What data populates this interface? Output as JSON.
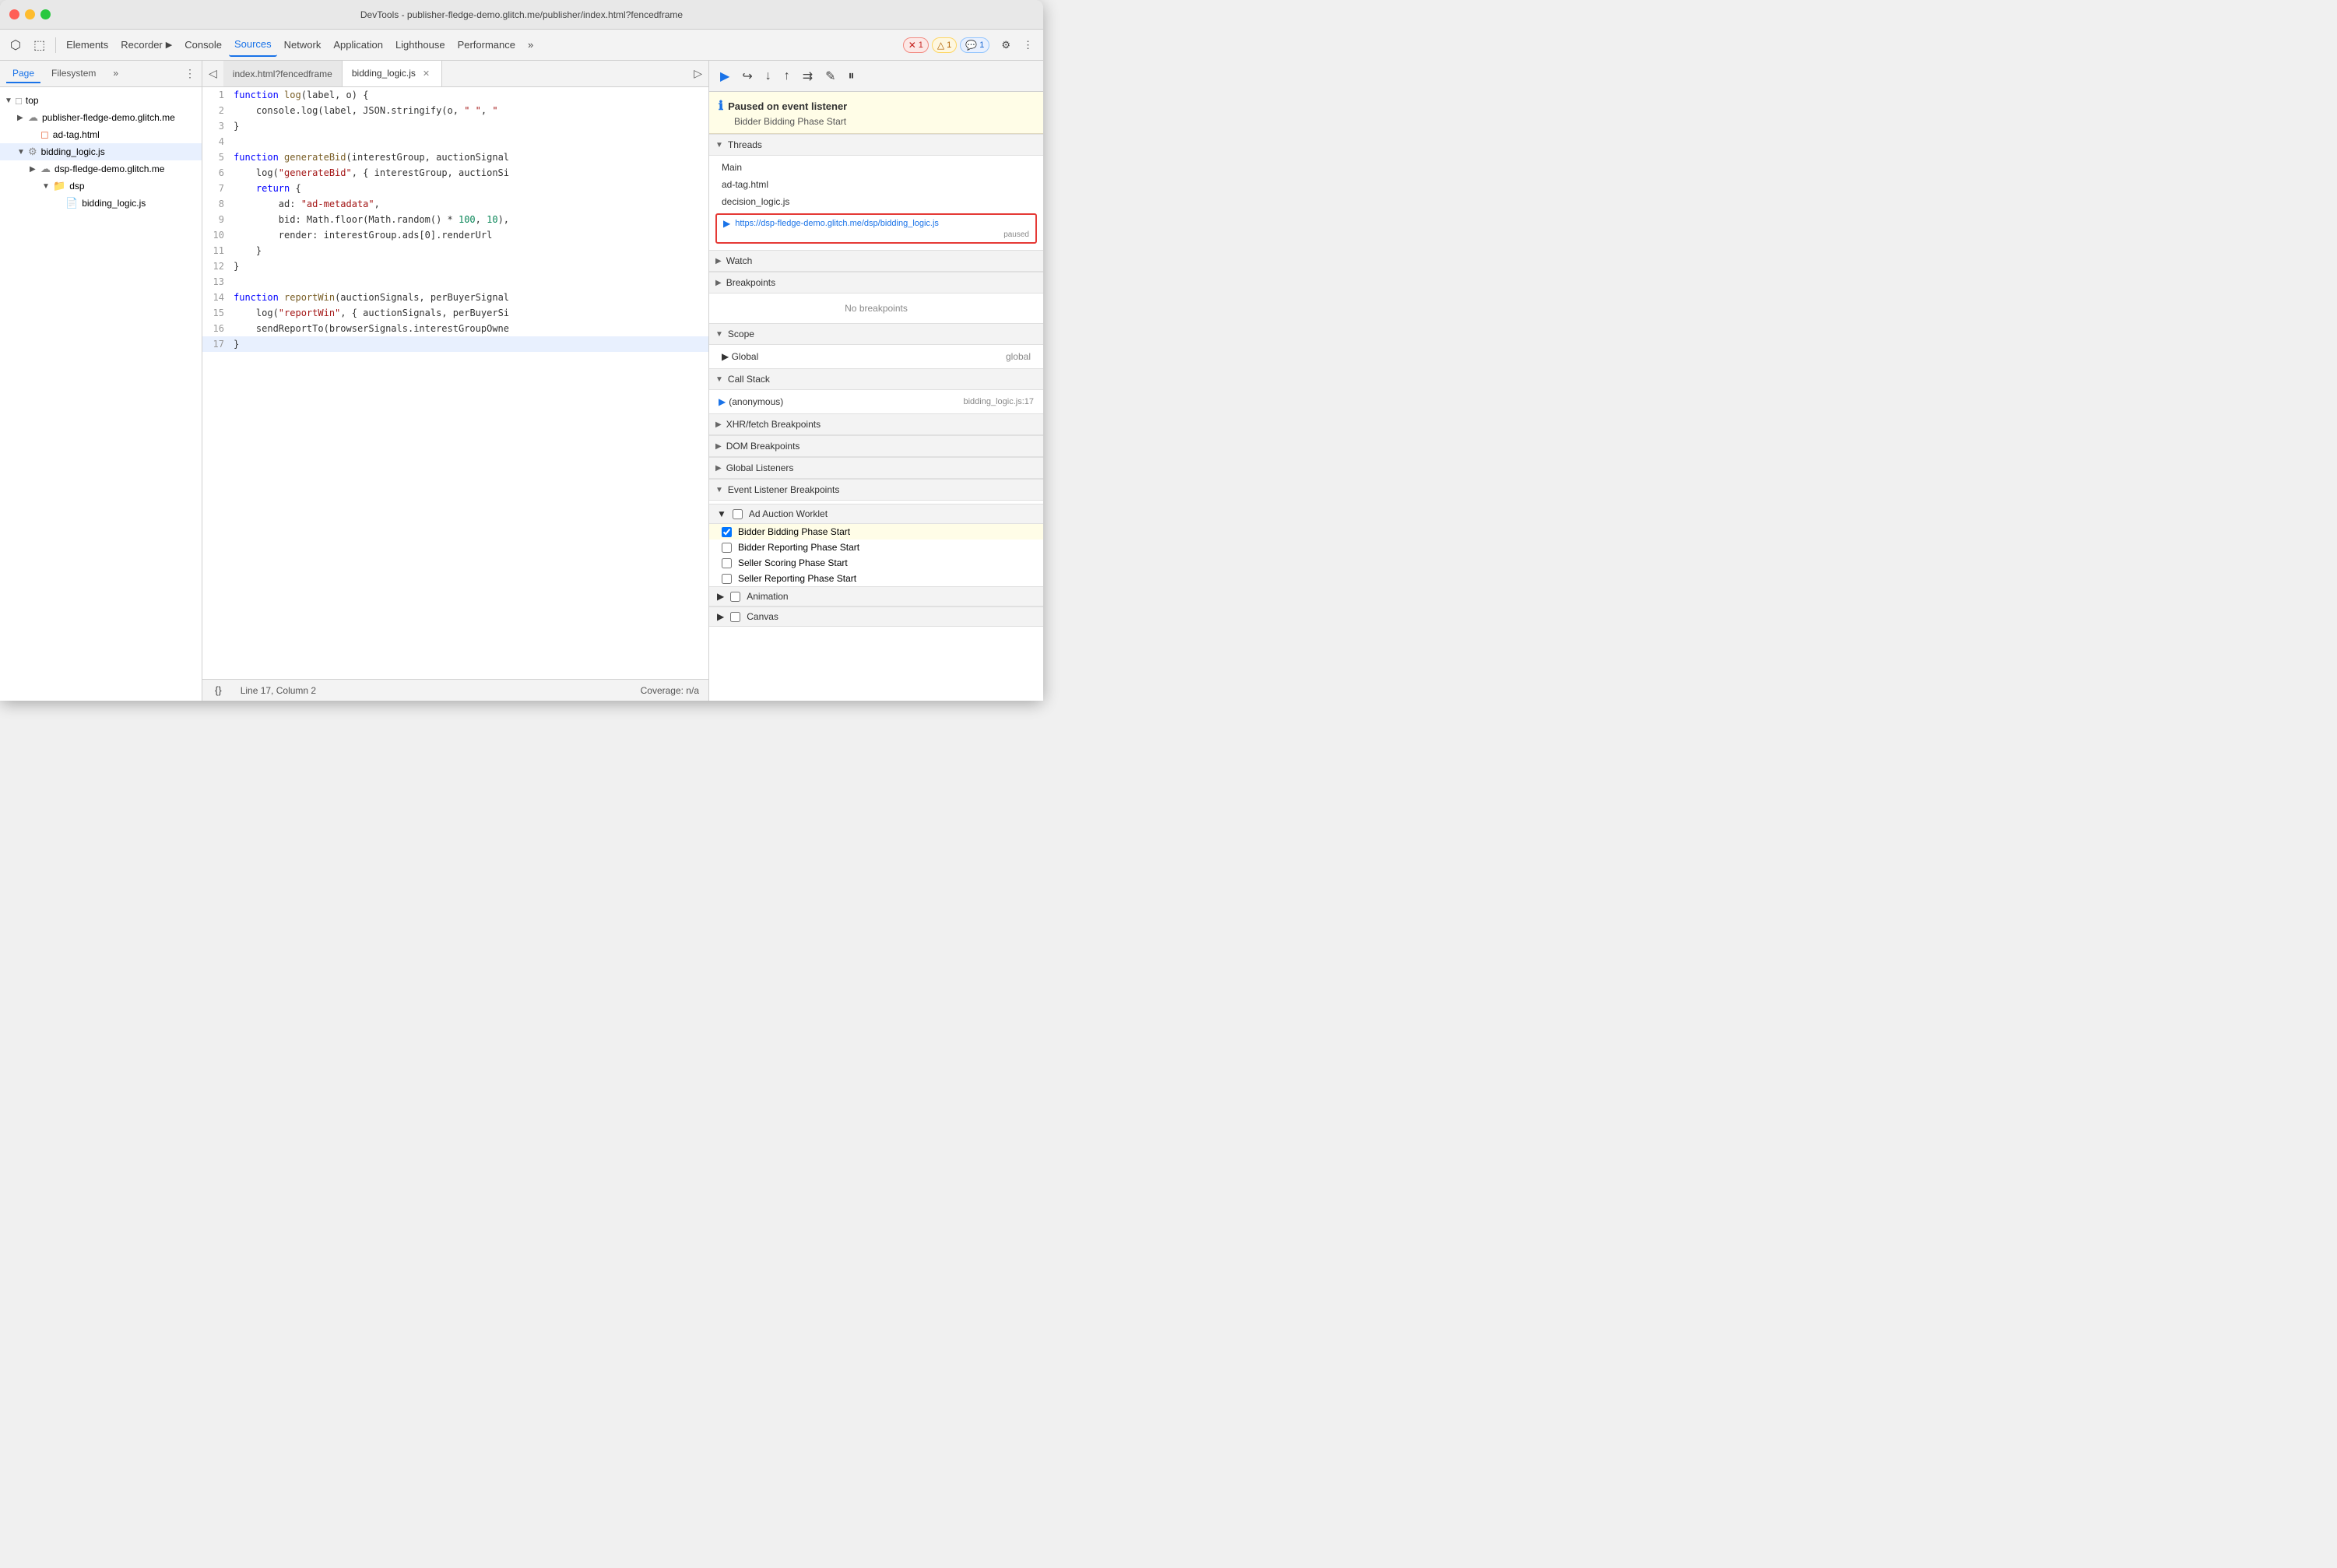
{
  "titleBar": {
    "title": "DevTools - publisher-fledge-demo.glitch.me/publisher/index.html?fencedframe"
  },
  "toolbar": {
    "cursor_btn": "⬡",
    "inspect_btn": "⬚",
    "elements_label": "Elements",
    "recorder_label": "Recorder",
    "recorder_icon": "▶",
    "console_label": "Console",
    "sources_label": "Sources",
    "network_label": "Network",
    "application_label": "Application",
    "lighthouse_label": "Lighthouse",
    "performance_label": "Performance",
    "more_label": "»",
    "badge_error_count": "1",
    "badge_warning_count": "1",
    "badge_info_count": "1",
    "settings_icon": "⚙",
    "more_icon": "⋮"
  },
  "sidebar": {
    "tab_page": "Page",
    "tab_filesystem": "Filesystem",
    "more_tabs": "»",
    "tree": [
      {
        "indent": 0,
        "arrow": "▼",
        "icon": "□",
        "icon_type": "folder",
        "label": "top"
      },
      {
        "indent": 1,
        "arrow": "▶",
        "icon": "☁",
        "icon_type": "domain",
        "label": "publisher-fledge-demo.glitch.me"
      },
      {
        "indent": 2,
        "arrow": "",
        "icon": "◻",
        "icon_type": "html",
        "label": "ad-tag.html"
      },
      {
        "indent": 1,
        "arrow": "▼",
        "icon": "⚙",
        "icon_type": "js",
        "label": "bidding_logic.js",
        "selected": true
      },
      {
        "indent": 2,
        "arrow": "▶",
        "icon": "☁",
        "icon_type": "domain",
        "label": "dsp-fledge-demo.glitch.me"
      },
      {
        "indent": 3,
        "arrow": "▼",
        "icon": "📁",
        "icon_type": "folder",
        "label": "dsp"
      },
      {
        "indent": 4,
        "arrow": "",
        "icon": "📄",
        "icon_type": "jsfile",
        "label": "bidding_logic.js"
      }
    ]
  },
  "editorTabs": [
    {
      "label": "index.html?fencedframe",
      "active": false,
      "closeable": false
    },
    {
      "label": "bidding_logic.js",
      "active": true,
      "closeable": true
    }
  ],
  "code": {
    "lines": [
      {
        "num": 1,
        "text": "function log(label, o) {",
        "highlighted": false
      },
      {
        "num": 2,
        "text": "    console.log(label, JSON.stringify(o, \" \", \"",
        "highlighted": false
      },
      {
        "num": 3,
        "text": "}",
        "highlighted": false
      },
      {
        "num": 4,
        "text": "",
        "highlighted": false
      },
      {
        "num": 5,
        "text": "function generateBid(interestGroup, auctionSignal",
        "highlighted": false
      },
      {
        "num": 6,
        "text": "    log(\"generateBid\", { interestGroup, auctionSi",
        "highlighted": false
      },
      {
        "num": 7,
        "text": "    return {",
        "highlighted": false
      },
      {
        "num": 8,
        "text": "        ad: \"ad-metadata\",",
        "highlighted": false
      },
      {
        "num": 9,
        "text": "        bid: Math.floor(Math.random() * 100, 10),",
        "highlighted": false
      },
      {
        "num": 10,
        "text": "        render: interestGroup.ads[0].renderUrl",
        "highlighted": false
      },
      {
        "num": 11,
        "text": "    }",
        "highlighted": false
      },
      {
        "num": 12,
        "text": "}",
        "highlighted": false
      },
      {
        "num": 13,
        "text": "",
        "highlighted": false
      },
      {
        "num": 14,
        "text": "function reportWin(auctionSignals, perBuyerSignal",
        "highlighted": false
      },
      {
        "num": 15,
        "text": "    log(\"reportWin\", { auctionSignals, perBuyerSi",
        "highlighted": false
      },
      {
        "num": 16,
        "text": "    sendReportTo(browserSignals.interestGroupOwne",
        "highlighted": false
      },
      {
        "num": 17,
        "text": "}",
        "highlighted": true
      }
    ]
  },
  "statusBar": {
    "format_btn": "{}",
    "line_col": "Line 17, Column 2",
    "coverage": "Coverage: n/a"
  },
  "debugger": {
    "paused_title": "Paused on event listener",
    "paused_subtitle": "Bidder Bidding Phase Start",
    "threads_label": "Threads",
    "threads": [
      {
        "label": "Main"
      },
      {
        "label": "ad-tag.html"
      },
      {
        "label": "decision_logic.js"
      }
    ],
    "active_thread_url": "https://dsp-fledge-demo.glitch.me/dsp/bidding_logic.js",
    "active_thread_status": "paused",
    "watch_label": "Watch",
    "breakpoints_label": "Breakpoints",
    "no_breakpoints": "No breakpoints",
    "scope_label": "Scope",
    "global_label": "Global",
    "global_value": "global",
    "call_stack_label": "Call Stack",
    "call_stack_items": [
      {
        "name": "(anonymous)",
        "location": "bidding_logic.js:17"
      }
    ],
    "xhr_breakpoints_label": "XHR/fetch Breakpoints",
    "dom_breakpoints_label": "DOM Breakpoints",
    "global_listeners_label": "Global Listeners",
    "event_listener_label": "Event Listener Breakpoints",
    "ad_auction_worklet_label": "Ad Auction Worklet",
    "event_checkboxes": [
      {
        "label": "Bidder Bidding Phase Start",
        "checked": true,
        "highlighted": true
      },
      {
        "label": "Bidder Reporting Phase Start",
        "checked": false,
        "highlighted": false
      },
      {
        "label": "Seller Scoring Phase Start",
        "checked": false,
        "highlighted": false
      },
      {
        "label": "Seller Reporting Phase Start",
        "checked": false,
        "highlighted": false
      }
    ],
    "animation_label": "Animation",
    "canvas_label": "Canvas"
  }
}
